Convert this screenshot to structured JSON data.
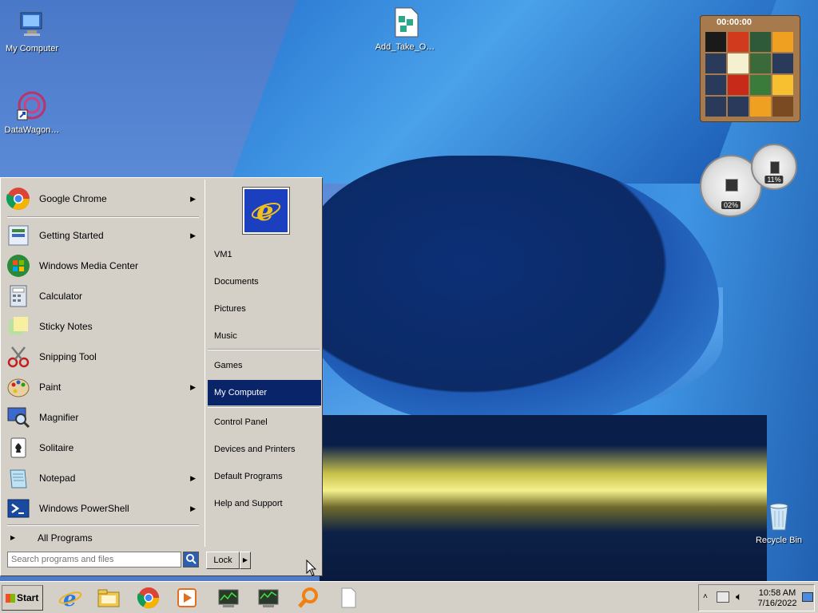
{
  "desktop": {
    "icons": [
      {
        "label": "My Computer",
        "icon": "computer-icon"
      },
      {
        "label": "DataWagon…",
        "icon": "datawagon-icon"
      },
      {
        "label": "Add_Take_O…",
        "icon": "registry-file-icon"
      },
      {
        "label": "Recycle Bin",
        "icon": "recycle-bin-icon"
      }
    ],
    "gadgets": {
      "puzzle_timer": "00:00:00",
      "cpu_meter": "02%",
      "ram_meter": "11%"
    }
  },
  "start_menu": {
    "programs": [
      {
        "label": "Google Chrome",
        "icon": "chrome-icon",
        "has_submenu": true
      },
      {
        "label": "Getting Started",
        "icon": "getting-started-icon",
        "has_submenu": true
      },
      {
        "label": "Windows Media Center",
        "icon": "media-center-icon",
        "has_submenu": false
      },
      {
        "label": "Calculator",
        "icon": "calculator-icon",
        "has_submenu": false
      },
      {
        "label": "Sticky Notes",
        "icon": "sticky-notes-icon",
        "has_submenu": false
      },
      {
        "label": "Snipping Tool",
        "icon": "scissors-icon",
        "has_submenu": false
      },
      {
        "label": "Paint",
        "icon": "paint-palette-icon",
        "has_submenu": true
      },
      {
        "label": "Magnifier",
        "icon": "magnifier-icon",
        "has_submenu": false
      },
      {
        "label": "Solitaire",
        "icon": "cards-icon",
        "has_submenu": false
      },
      {
        "label": "Notepad",
        "icon": "notepad-icon",
        "has_submenu": true
      },
      {
        "label": "Windows PowerShell",
        "icon": "powershell-icon",
        "has_submenu": true
      }
    ],
    "all_programs": "All Programs",
    "search_placeholder": "Search programs and files",
    "lock_label": "Lock",
    "right_links": [
      {
        "label": "VM1"
      },
      {
        "label": "Documents"
      },
      {
        "label": "Pictures"
      },
      {
        "label": "Music"
      },
      {
        "label": "Games"
      },
      {
        "label": "My Computer",
        "selected": true
      },
      {
        "label": "Control Panel"
      },
      {
        "label": "Devices and Printers"
      },
      {
        "label": "Default Programs"
      },
      {
        "label": "Help and Support"
      }
    ]
  },
  "taskbar": {
    "start_label": "Start",
    "pinned": [
      "ie-icon",
      "explorer-icon",
      "chrome-icon",
      "media-player-icon",
      "network-monitor-icon",
      "network-monitor-icon",
      "search-magnifier-icon",
      "blank-document-icon"
    ],
    "tray": {
      "time": "10:58 AM",
      "date": "7/16/2022"
    }
  },
  "colors": {
    "menu_bg": "#d4d0c8",
    "selection": "#0a246a"
  }
}
